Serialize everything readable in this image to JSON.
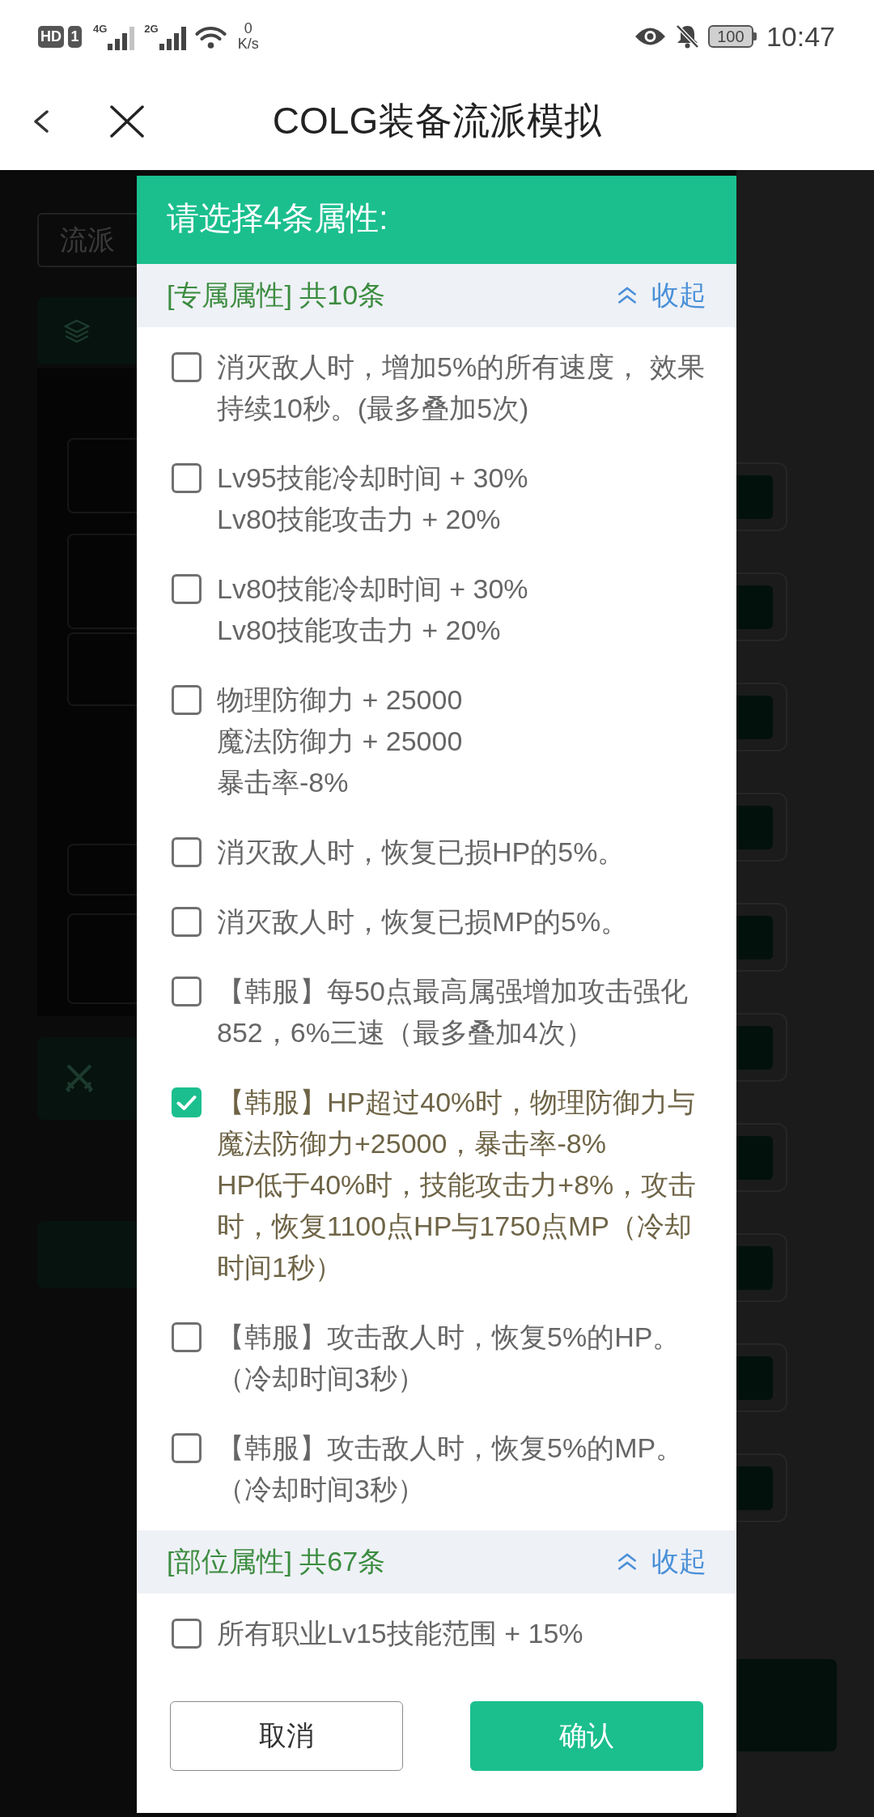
{
  "status_bar": {
    "hd_badge": "HD",
    "sim_badge": "1",
    "sim1_network": "4G",
    "sim2_network": "2G",
    "speed_value": "0",
    "speed_unit": "K/s",
    "battery_text": "100",
    "time": "10:47"
  },
  "header": {
    "title": "COLG装备流派模拟"
  },
  "background": {
    "tab_label": "流派"
  },
  "dialog": {
    "title": "请选择4条属性:",
    "sections": [
      {
        "title": "[专属属性] 共10条",
        "toggle": "收起",
        "expanded": true,
        "items": [
          {
            "text": "消灭敌人时，增加5%的所有速度， 效果持续10秒。(最多叠加5次)",
            "checked": false
          },
          {
            "text": "Lv95技能冷却时间 + 30%\nLv80技能攻击力 + 20%",
            "checked": false
          },
          {
            "text": "Lv80技能冷却时间 + 30%\nLv80技能攻击力 + 20%",
            "checked": false
          },
          {
            "text": "物理防御力 + 25000\n魔法防御力 + 25000\n暴击率-8%",
            "checked": false
          },
          {
            "text": "消灭敌人时，恢复已损HP的5%。",
            "checked": false
          },
          {
            "text": "消灭敌人时，恢复已损MP的5%。",
            "checked": false
          },
          {
            "text": "【韩服】每50点最高属强增加攻击强化852，6%三速（最多叠加4次）",
            "checked": false
          },
          {
            "text": "【韩服】HP超过40%时，物理防御力与魔法防御力+25000，暴击率-8%\nHP低于40%时，技能攻击力+8%，攻击时，恢复1100点HP与1750点MP（冷却时间1秒）",
            "checked": true
          },
          {
            "text": "【韩服】攻击敌人时，恢复5%的HP。（冷却时间3秒）",
            "checked": false
          },
          {
            "text": "【韩服】攻击敌人时，恢复5%的MP。（冷却时间3秒）",
            "checked": false
          }
        ]
      },
      {
        "title": "[部位属性] 共67条",
        "toggle": "收起",
        "expanded": true,
        "items": [
          {
            "text": "所有职业Lv15技能范围 + 15%",
            "checked": false
          }
        ]
      }
    ],
    "buttons": [
      {
        "label": "取消",
        "kind": "secondary"
      },
      {
        "label": "确认",
        "kind": "primary"
      }
    ]
  }
}
